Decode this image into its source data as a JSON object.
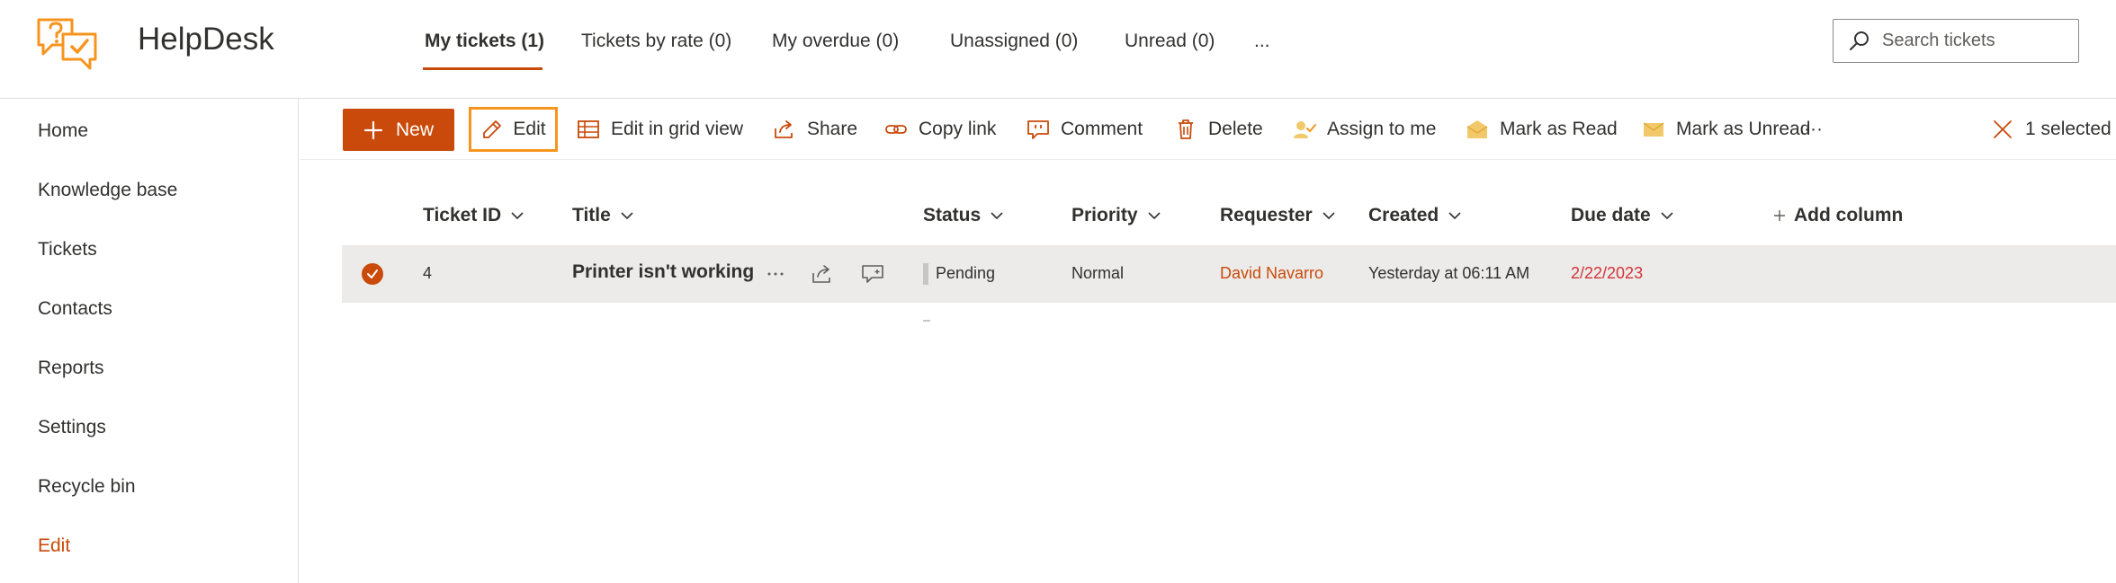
{
  "app": {
    "title": "HelpDesk"
  },
  "tabs": [
    {
      "label": "My tickets (1)",
      "active": true
    },
    {
      "label": "Tickets by rate (0)"
    },
    {
      "label": "My overdue (0)"
    },
    {
      "label": "Unassigned (0)"
    },
    {
      "label": "Unread (0)"
    },
    {
      "label": "..."
    }
  ],
  "search": {
    "placeholder": "Search tickets"
  },
  "sidebar": {
    "items": [
      {
        "label": "Home"
      },
      {
        "label": "Knowledge base"
      },
      {
        "label": "Tickets"
      },
      {
        "label": "Contacts"
      },
      {
        "label": "Reports"
      },
      {
        "label": "Settings"
      },
      {
        "label": "Recycle bin"
      },
      {
        "label": "Edit"
      }
    ]
  },
  "commands": {
    "new": "New",
    "edit": "Edit",
    "edit_grid": "Edit in grid view",
    "share": "Share",
    "copy_link": "Copy link",
    "comment": "Comment",
    "delete": "Delete",
    "assign": "Assign to me",
    "mark_read": "Mark as Read",
    "mark_unread": "Mark as Unread",
    "more": "···",
    "selected": "1 selected"
  },
  "table": {
    "columns": [
      "Ticket ID",
      "Title",
      "Status",
      "Priority",
      "Requester",
      "Created",
      "Due date"
    ],
    "add_column": "Add column",
    "rows": [
      {
        "id": "4",
        "title": "Printer isn't working",
        "status": "Pending",
        "priority": "Normal",
        "requester": "David Navarro",
        "created": "Yesterday at 06:11 AM",
        "due": "2/22/2023"
      }
    ]
  },
  "colors": {
    "accent": "#c94a0a",
    "highlight": "#f7941d",
    "due_red": "#d13438",
    "row_selected": "#edebe9"
  }
}
